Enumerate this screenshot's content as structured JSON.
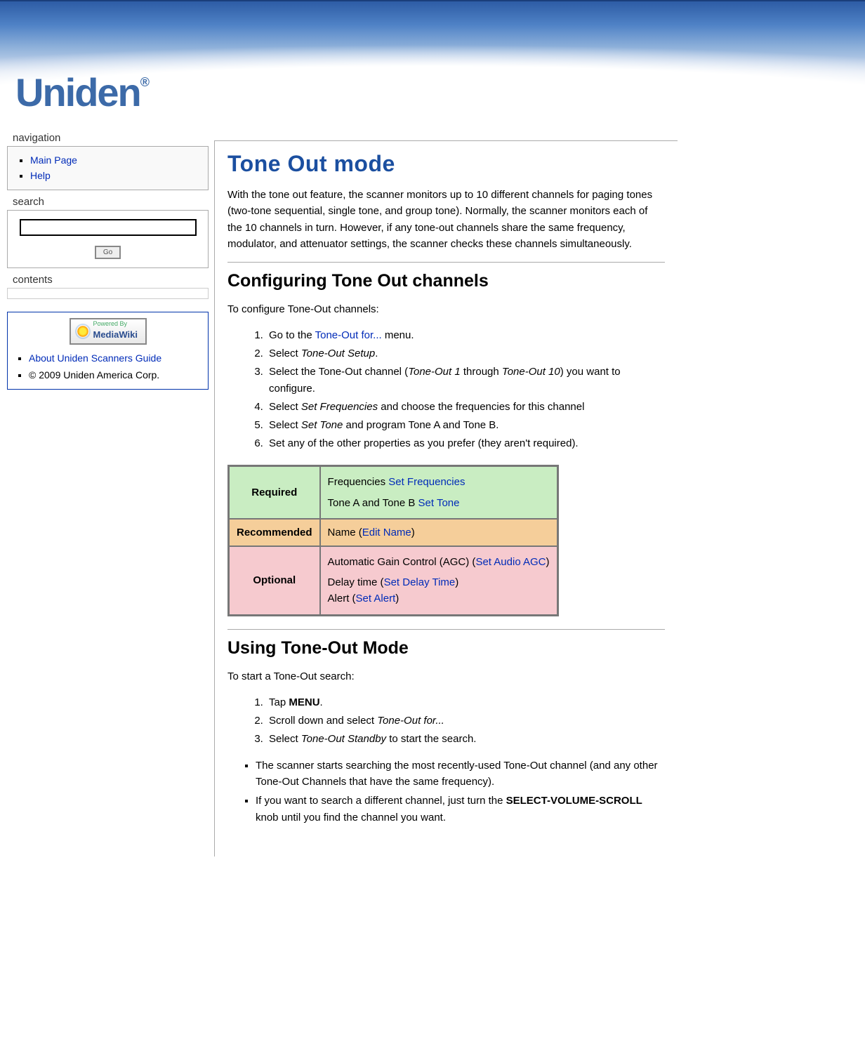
{
  "logo_text": "Uniden",
  "nav": {
    "title": "navigation",
    "items": [
      "Main Page",
      "Help"
    ]
  },
  "search": {
    "title": "search",
    "value": "",
    "go_label": "Go"
  },
  "contents": {
    "title": "contents"
  },
  "about": {
    "badge_powered": "Powered By",
    "badge_name": "MediaWiki",
    "link_label": "About Uniden Scanners Guide",
    "copyright": "© 2009 Uniden America Corp."
  },
  "page": {
    "title": "Tone Out mode",
    "intro": "With the tone out feature, the scanner monitors up to 10 different channels for paging tones (two-tone sequential, single tone, and group tone). Normally, the scanner monitors each of the 10 channels in turn. However, if any tone-out channels share the same frequency, modulator, and attenuator settings, the scanner checks these channels simultaneously.",
    "config_heading": "Configuring Tone Out channels",
    "config_intro": "To configure Tone-Out channels:",
    "config_steps": {
      "s1_a": "Go to the ",
      "s1_link": "Tone-Out for...",
      "s1_b": " menu.",
      "s2_a": "Select ",
      "s2_i": "Tone-Out Setup",
      "s2_b": ".",
      "s3_a": "Select the Tone-Out channel (",
      "s3_i1": "Tone-Out 1",
      "s3_mid": " through ",
      "s3_i2": "Tone-Out 10",
      "s3_b": ") you want to configure.",
      "s4_a": "Select ",
      "s4_i": "Set Frequencies",
      "s4_b": " and choose the frequencies for this channel",
      "s5_a": "Select ",
      "s5_i": "Set Tone",
      "s5_b": " and program Tone A and Tone B.",
      "s6": "Set any of the other properties as you prefer (they aren't required)."
    },
    "table": {
      "required_label": "Required",
      "required_r1_a": "Frequencies ",
      "required_r1_link": "Set Frequencies",
      "required_r2_a": "Tone A and Tone B ",
      "required_r2_link": "Set Tone",
      "recommended_label": "Recommended",
      "recommended_a": "Name (",
      "recommended_link": "Edit Name",
      "recommended_b": ")",
      "optional_label": "Optional",
      "optional_r1_a": "Automatic Gain Control (AGC) (",
      "optional_r1_link": "Set Audio AGC",
      "optional_r1_b": ")",
      "optional_r2_a": "Delay time (",
      "optional_r2_link": "Set Delay Time",
      "optional_r2_b": ")",
      "optional_r3_a": "Alert (",
      "optional_r3_link": "Set Alert",
      "optional_r3_b": ")"
    },
    "using_heading": "Using Tone-Out Mode",
    "using_intro": "To start a Tone-Out search:",
    "using_steps": {
      "s1_a": "Tap ",
      "s1_b": "MENU",
      "s1_c": ".",
      "s2_a": "Scroll down and select ",
      "s2_i": "Tone-Out for...",
      "s3_a": "Select ",
      "s3_i": "Tone-Out Standby",
      "s3_b": " to start the search."
    },
    "using_bullets": {
      "b1": "The scanner starts searching the most recently-used Tone-Out channel (and any other Tone-Out Channels that have the same frequency).",
      "b2_a": "If you want to search a different channel, just turn the ",
      "b2_b": "SELECT-VOLUME-SCROLL",
      "b2_c": " knob until you find the channel you want."
    }
  }
}
